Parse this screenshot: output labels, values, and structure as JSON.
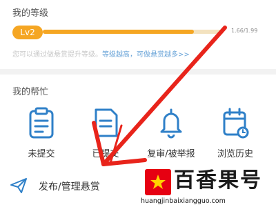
{
  "level": {
    "title": "我的等级",
    "badge": "Lv2",
    "progress_text": "1.66/1.99",
    "progress_value": 1.66,
    "progress_max": 1.99,
    "hint_text": "您可以通过做悬赏提升等级。",
    "hint_link": "等级越高，可做悬赏越多>>"
  },
  "help": {
    "title": "我的帮忙",
    "items": [
      {
        "label": "未提交",
        "icon": "clipboard-icon"
      },
      {
        "label": "已提交",
        "icon": "document-icon"
      },
      {
        "label": "复审/被举报",
        "icon": "bell-icon"
      },
      {
        "label": "浏览历史",
        "icon": "calendar-clock-icon"
      }
    ]
  },
  "publish": {
    "label": "发布/管理悬赏",
    "icon": "paper-plane-icon"
  },
  "watermark": {
    "title": "百香果号",
    "url": "huangjinbaixiangguo.com"
  },
  "colors": {
    "accent": "#f5a623",
    "icon_blue": "#2f80c8",
    "annotation_red": "#e8241b",
    "link_blue": "#6aa4d8"
  }
}
